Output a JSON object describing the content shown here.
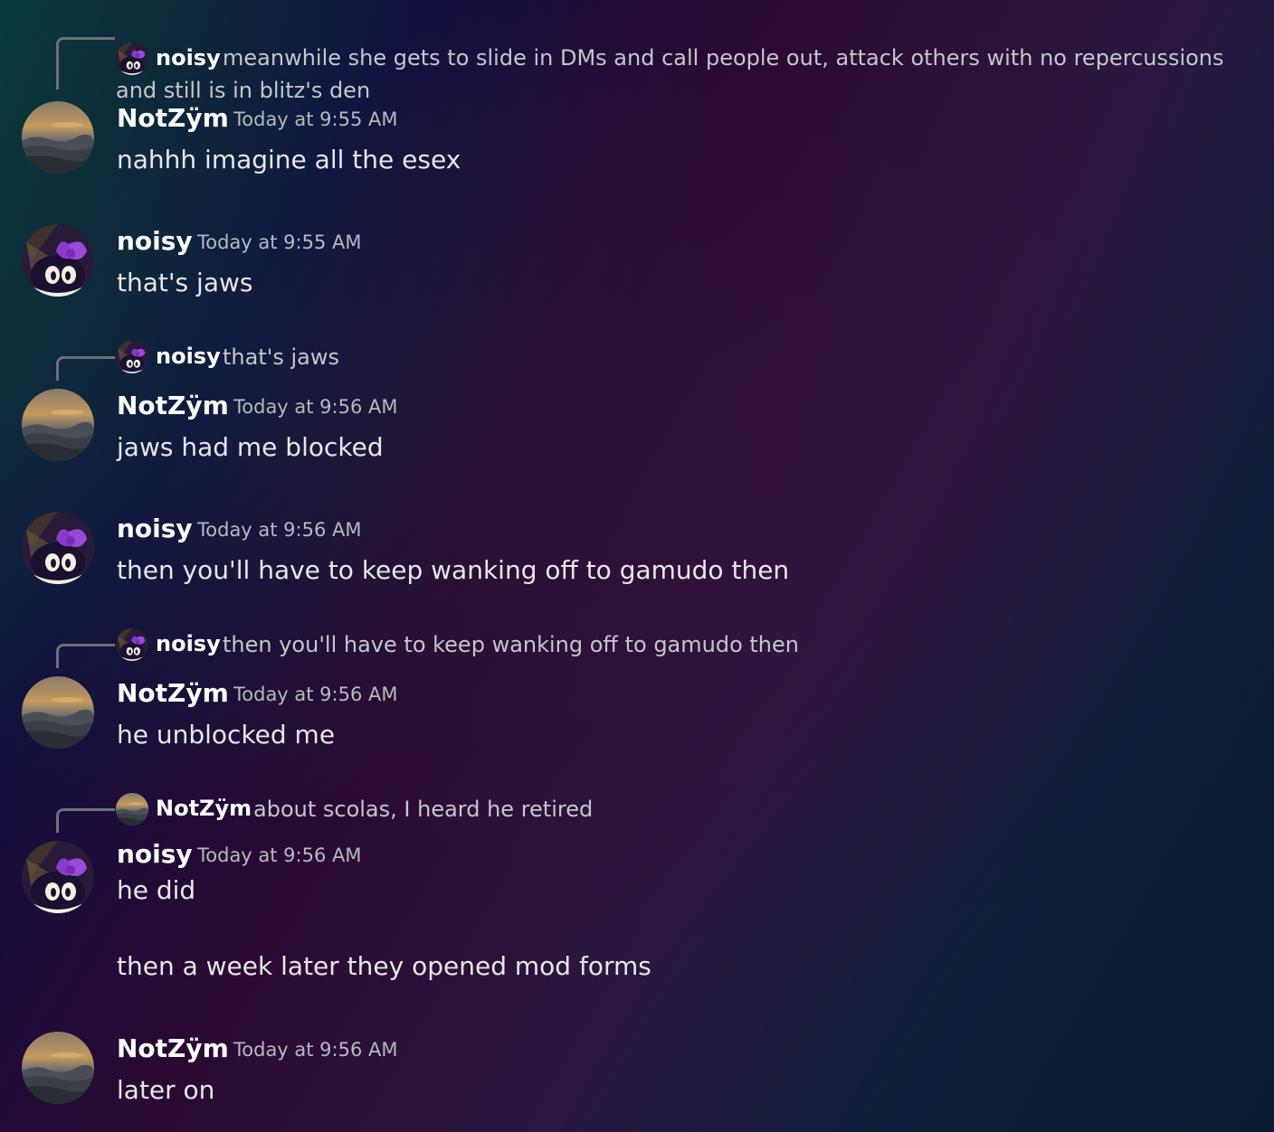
{
  "users": {
    "noisy": "noisy",
    "notzym": "NotZÿm"
  },
  "messages": [
    {
      "reply": {
        "author": "noisy",
        "text": "meanwhile she gets to slide in DMs and call people out, attack others with no repercussions and still is in blitz's den"
      },
      "author": "NotZÿm",
      "time": "Today at 9:55 AM",
      "lines": [
        "nahhh imagine all the esex"
      ]
    },
    {
      "author": "noisy",
      "time": "Today at 9:55 AM",
      "lines": [
        "that's jaws"
      ]
    },
    {
      "reply": {
        "author": "noisy",
        "text": "that's jaws"
      },
      "author": "NotZÿm",
      "time": "Today at 9:56 AM",
      "lines": [
        "jaws had me blocked"
      ]
    },
    {
      "author": "noisy",
      "time": "Today at 9:56 AM",
      "lines": [
        "then you'll have to keep wanking off to gamudo then"
      ]
    },
    {
      "reply": {
        "author": "noisy",
        "text": "then you'll have to keep wanking off to gamudo then"
      },
      "author": "NotZÿm",
      "time": "Today at 9:56 AM",
      "lines": [
        "he unblocked me"
      ]
    },
    {
      "reply": {
        "author": "NotZÿm",
        "text": "about scolas, I heard he retired"
      },
      "author": "noisy",
      "time": "Today at 9:56 AM",
      "lines": [
        "he did",
        "then a week later they opened mod forms"
      ]
    },
    {
      "author": "NotZÿm",
      "time": "Today at 9:56 AM",
      "lines": [
        "later on"
      ]
    }
  ],
  "icons": {
    "notzym_avatar": "landscape-avatar",
    "noisy_avatar": "purple-creature-avatar"
  }
}
